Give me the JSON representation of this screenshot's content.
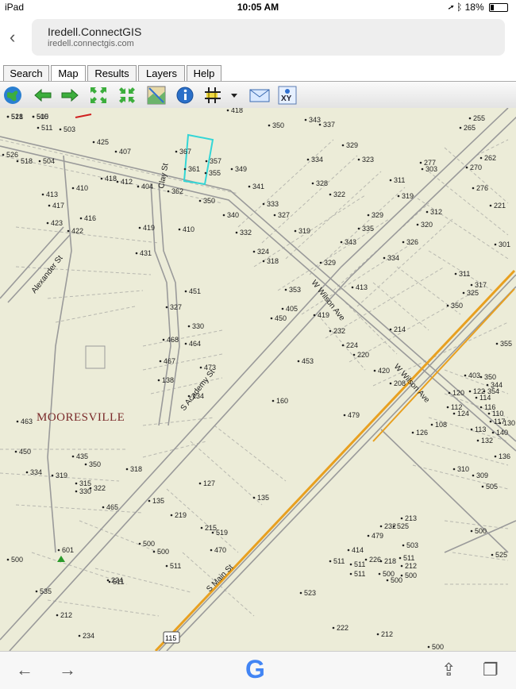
{
  "status": {
    "device": "iPad",
    "time": "10:05 AM",
    "battery": "18%",
    "battery_level": 0.18
  },
  "browser": {
    "back_glyph": "‹",
    "page_title": "Iredell.ConnectGIS",
    "url": "iredell.connectgis.com"
  },
  "tabs": [
    {
      "label": "Search",
      "active": false
    },
    {
      "label": "Map",
      "active": true
    },
    {
      "label": "Results",
      "active": false
    },
    {
      "label": "Layers",
      "active": false
    },
    {
      "label": "Help",
      "active": false
    }
  ],
  "toolbar": {
    "icons": [
      "globe-icon",
      "back-arrow-icon",
      "forward-arrow-icon",
      "zoom-in-icon",
      "zoom-out-icon",
      "map-thumb-icon",
      "info-icon",
      "grid-select-icon",
      "dropdown-caret-icon",
      "mail-icon",
      "xy-icon"
    ],
    "xy_label": "XY"
  },
  "map": {
    "colors": {
      "background": "#ececd8",
      "road": "#9a9a9a",
      "lot": "#b8b8b0",
      "highway": "#e8a020",
      "highlight": "#33d6d6",
      "label": "#222222",
      "town": "#7a2a2a"
    },
    "town_label": "MOORESVILLE",
    "street_labels": [
      "W Wilson Ave",
      "W Wilson Ave",
      "S Academy St",
      "S Main St",
      "Clay St",
      "Alexander St"
    ],
    "route_shield": "115",
    "parcel_numbers": [
      "521",
      "515",
      "511",
      "503",
      "425",
      "407",
      "367",
      "357",
      "355",
      "361",
      "418",
      "350",
      "343",
      "337",
      "329",
      "265",
      "255",
      "526",
      "518",
      "504",
      "410",
      "418",
      "412",
      "404",
      "362",
      "350",
      "340",
      "334",
      "323",
      "277",
      "303",
      "262",
      "270",
      "349",
      "341",
      "333",
      "328",
      "322",
      "311",
      "319",
      "276",
      "413",
      "417",
      "416",
      "423",
      "422",
      "419",
      "410",
      "332",
      "327",
      "319",
      "329",
      "335",
      "312",
      "320",
      "301",
      "221",
      "431",
      "324",
      "318",
      "343",
      "326",
      "334",
      "311",
      "317",
      "325",
      "329",
      "353",
      "405",
      "413",
      "350",
      "327",
      "451",
      "450",
      "419",
      "232",
      "224",
      "220",
      "214",
      "355",
      "330",
      "464",
      "468",
      "467",
      "473",
      "453",
      "420",
      "208",
      "403",
      "350",
      "344",
      "120",
      "122",
      "354",
      "114",
      "116",
      "112",
      "124",
      "110",
      "108",
      "126",
      "117",
      "113",
      "130",
      "140",
      "132",
      "136",
      "138",
      "134",
      "160",
      "479",
      "463",
      "450",
      "435",
      "350",
      "334",
      "319",
      "315",
      "330",
      "322",
      "318",
      "310",
      "309",
      "505",
      "127",
      "135",
      "135",
      "219",
      "465",
      "232",
      "224",
      "215",
      "519",
      "470",
      "525",
      "213",
      "479",
      "503",
      "500",
      "500",
      "500",
      "511",
      "414",
      "226",
      "218",
      "212",
      "500",
      "511",
      "511",
      "511",
      "511",
      "500",
      "500",
      "500",
      "511",
      "601",
      "525",
      "535",
      "212",
      "234",
      "222",
      "212",
      "500",
      "523",
      "518",
      "500"
    ]
  },
  "bottom": {
    "back_glyph": "←",
    "forward_glyph": "→",
    "google_letter": "G",
    "share_glyph": "⇪",
    "tabs_glyph": "❐"
  }
}
